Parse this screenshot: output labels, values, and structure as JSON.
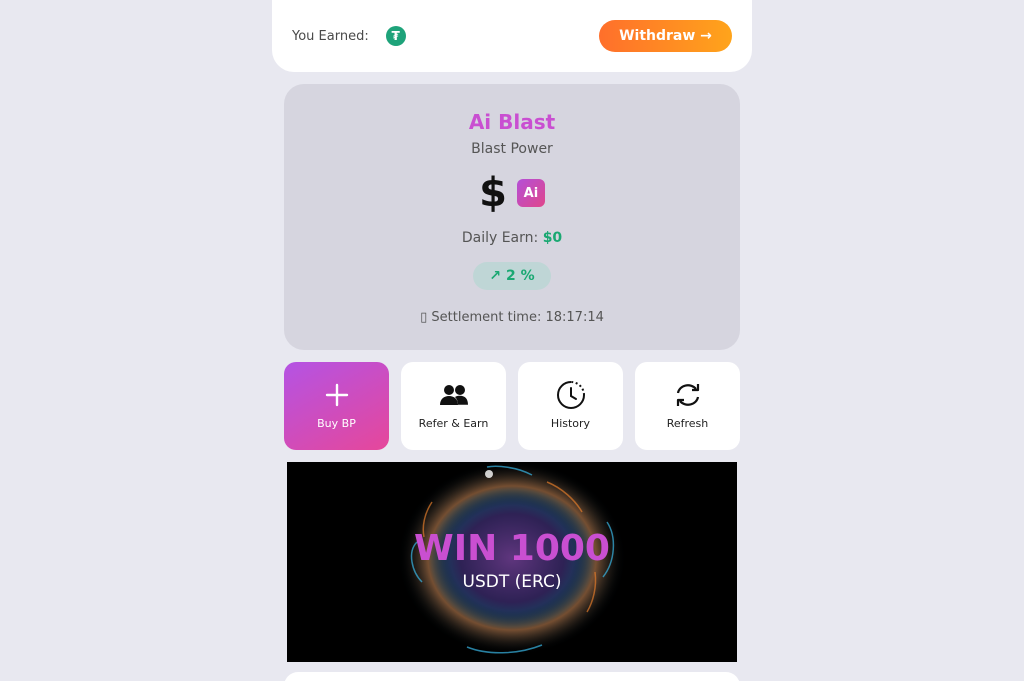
{
  "header": {
    "earned_label": "You Earned:",
    "currency_icon": "tether-icon",
    "currency_glyph": "₮",
    "withdraw_label": "Withdraw →"
  },
  "blast": {
    "title": "Ai Blast",
    "subtitle": "Blast Power",
    "power_value": "$",
    "badge": "Ai",
    "daily_label": "Daily Earn:",
    "daily_value": "$0",
    "percent": "↗ 2 %",
    "settlement_icon_glyph": "▯",
    "settlement_label": "Settlement time:",
    "settlement_time": "18:17:14"
  },
  "actions": [
    {
      "label": "Buy BP",
      "icon": "plus-icon"
    },
    {
      "label": "Refer & Earn",
      "icon": "users-icon"
    },
    {
      "label": "History",
      "icon": "clock-history-icon"
    },
    {
      "label": "Refresh",
      "icon": "refresh-icon"
    }
  ],
  "banner": {
    "title": "WIN 1000",
    "subtitle": "USDT (ERC)"
  },
  "colors": {
    "accent_purple": "#c94fd1",
    "green": "#1aa872",
    "withdraw_start": "#ff6f2b",
    "withdraw_end": "#ffa41b",
    "background": "#e8e8f0"
  }
}
